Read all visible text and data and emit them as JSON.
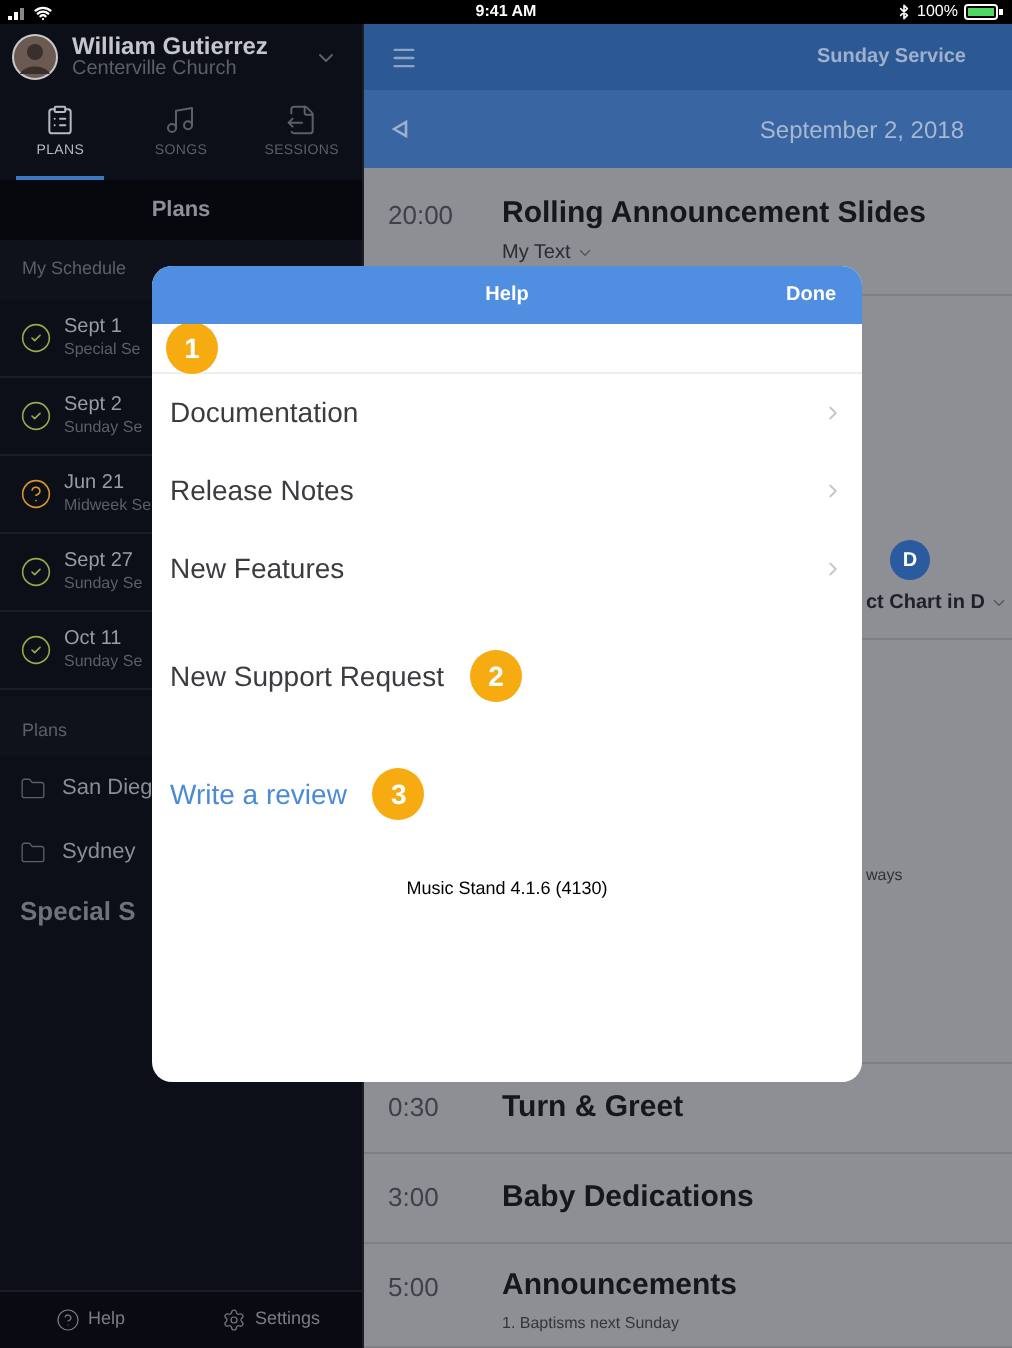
{
  "status_bar": {
    "time": "9:41 AM",
    "battery": "100%"
  },
  "sidebar": {
    "user": {
      "name": "William Gutierrez",
      "church": "Centerville Church"
    },
    "tabs": [
      {
        "label": "PLANS",
        "selected": true
      },
      {
        "label": "SONGS",
        "selected": false
      },
      {
        "label": "SESSIONS",
        "selected": false
      }
    ],
    "title": "Plans",
    "schedule_heading": "My Schedule",
    "schedule": [
      {
        "date": "Sept 1",
        "subtitle": "Special Se",
        "confirmed": true
      },
      {
        "date": "Sept 2",
        "subtitle": "Sunday Se",
        "confirmed": true
      },
      {
        "date": "Jun 21",
        "subtitle": "Midweek Se",
        "confirmed": false
      },
      {
        "date": "Sept 27",
        "subtitle": "Sunday Se",
        "confirmed": true
      },
      {
        "date": "Oct 11",
        "subtitle": "Sunday Se",
        "confirmed": true
      }
    ],
    "plans_heading": "Plans",
    "folders": [
      {
        "name": "San Dieg"
      },
      {
        "name": "Sydney"
      }
    ],
    "special": "Special S",
    "footer": [
      "Help",
      "Settings"
    ]
  },
  "main": {
    "title": "Sunday Service",
    "date": "September 2, 2018",
    "items": [
      {
        "kind": "item",
        "time": "20:00",
        "title": "Rolling Announcement Slides",
        "subtitle": "My Text"
      },
      {
        "kind": "chart",
        "key": "D",
        "label": "ct Chart in D"
      },
      {
        "kind": "note",
        "text": "ways"
      },
      {
        "kind": "item",
        "time": "0:30",
        "title": "Turn & Greet"
      },
      {
        "kind": "item",
        "time": "3:00",
        "title": "Baby Dedications"
      },
      {
        "kind": "item",
        "time": "5:00",
        "title": "Announcements",
        "note": "1. Baptisms next Sunday"
      }
    ]
  },
  "dialog": {
    "title": "Help",
    "done": "Done",
    "top_badge": "1",
    "rows": [
      {
        "kind": "nav",
        "label": "Documentation"
      },
      {
        "kind": "nav",
        "label": "Release Notes"
      },
      {
        "kind": "nav",
        "label": "New Features"
      },
      {
        "kind": "action",
        "label": "New Support Request",
        "badge": "2"
      },
      {
        "kind": "link",
        "label": "Write a review",
        "badge": "3"
      }
    ],
    "version": "Music Stand 4.1.6 (4130)"
  }
}
